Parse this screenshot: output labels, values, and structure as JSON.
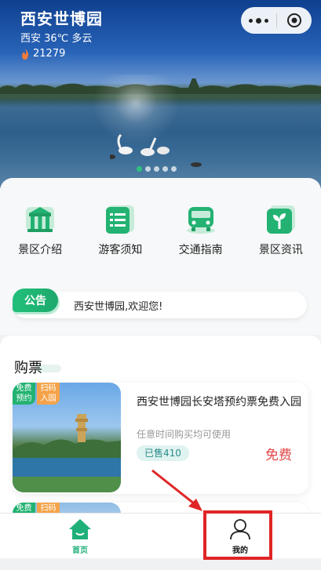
{
  "header": {
    "title": "西安世博园",
    "weather": "西安 36℃ 多云",
    "visits": "21279"
  },
  "carousel": {
    "total": 5,
    "active": 0
  },
  "categories": [
    {
      "label": "景区介绍",
      "icon": "scenic-intro-icon"
    },
    {
      "label": "游客须知",
      "icon": "visitor-notice-icon"
    },
    {
      "label": "交通指南",
      "icon": "traffic-guide-icon"
    },
    {
      "label": "景区资讯",
      "icon": "scenic-news-icon"
    }
  ],
  "notice": {
    "badge": "公告",
    "text": "西安世博园,欢迎您!"
  },
  "tickets": {
    "title": "购票",
    "items": [
      {
        "tag1": "免费预约",
        "tag2": "扫码入园",
        "name": "西安世博园长安塔预约票免费入园",
        "subtitle": "任意时间购买均可使用",
        "sold": "已售410",
        "price": "免费"
      },
      {
        "tag1": "免费",
        "tag2": "扫码"
      }
    ]
  },
  "tabbar": {
    "home": "首页",
    "me": "我的"
  },
  "colors": {
    "accent": "#1fb07a",
    "price": "#e14545",
    "annotation": "#e02525"
  }
}
